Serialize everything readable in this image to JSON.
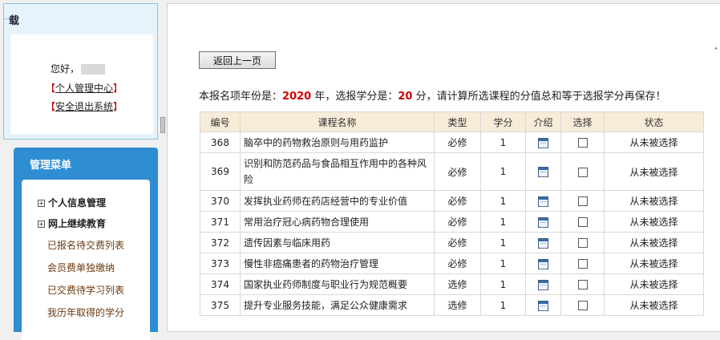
{
  "login": {
    "title": "载",
    "greeting": "您好，",
    "bracket_open": "【",
    "bracket_close": "】",
    "personal_center": "个人管理中心",
    "logout": "安全退出系统"
  },
  "menu": {
    "title": "管理菜单",
    "groups": [
      "个人信息管理",
      "网上继续教育"
    ],
    "items": [
      "已报名待交费列表",
      "会员费单独缴纳",
      "已交费待学习列表",
      "我历年取得的学分"
    ]
  },
  "main": {
    "back_button": "返回上一页",
    "corner_mark": "ˆ",
    "notice": {
      "prefix": "本报名项年份是：",
      "year": "2020",
      "middle": " 年，选报学分是：",
      "credits": "20",
      "suffix": " 分，请计算所选课程的分值总和等于选报学分再保存！"
    }
  },
  "table": {
    "headers": [
      "编号",
      "课程名称",
      "类型",
      "学分",
      "介绍",
      "选择",
      "状态"
    ],
    "rows": [
      {
        "id": "368",
        "name": "脑卒中的药物救治原则与用药监护",
        "type": "必修",
        "credit": "1",
        "status": "从未被选择"
      },
      {
        "id": "369",
        "name": "识别和防范药品与食品相互作用中的各种风险",
        "type": "必修",
        "credit": "1",
        "status": "从未被选择"
      },
      {
        "id": "370",
        "name": "发挥执业药师在药店经营中的专业价值",
        "type": "必修",
        "credit": "1",
        "status": "从未被选择"
      },
      {
        "id": "371",
        "name": "常用治疗冠心病药物合理使用",
        "type": "必修",
        "credit": "1",
        "status": "从未被选择"
      },
      {
        "id": "372",
        "name": "遗传因素与临床用药",
        "type": "必修",
        "credit": "1",
        "status": "从未被选择"
      },
      {
        "id": "373",
        "name": "慢性非癌痛患者的药物治疗管理",
        "type": "必修",
        "credit": "1",
        "status": "从未被选择"
      },
      {
        "id": "374",
        "name": "国家执业药师制度与职业行为规范概要",
        "type": "选修",
        "credit": "1",
        "status": "从未被选择"
      },
      {
        "id": "375",
        "name": "提升专业服务技能，满足公众健康需求",
        "type": "选修",
        "credit": "1",
        "status": "从未被选择"
      }
    ]
  }
}
